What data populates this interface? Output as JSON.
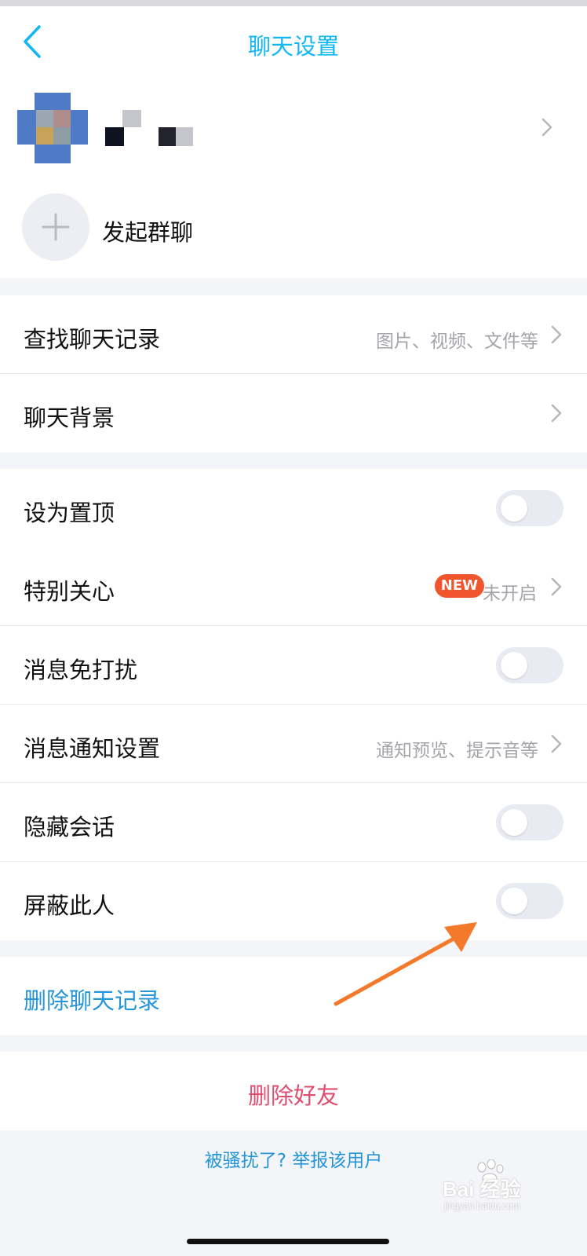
{
  "header": {
    "title": "聊天设置"
  },
  "profile": {
    "group_chat_label": "发起群聊"
  },
  "section_history": {
    "search": {
      "label": "查找聊天记录",
      "hint": "图片、视频、文件等"
    },
    "background": {
      "label": "聊天背景"
    }
  },
  "section_settings": {
    "pin": {
      "label": "设为置顶",
      "enabled": false
    },
    "special_care": {
      "label": "特别关心",
      "badge": "NEW",
      "status": "未开启"
    },
    "do_not_disturb": {
      "label": "消息免打扰",
      "enabled": false
    },
    "notification": {
      "label": "消息通知设置",
      "hint": "通知预览、提示音等"
    },
    "hide_chat": {
      "label": "隐藏会话",
      "enabled": false
    },
    "block": {
      "label": "屏蔽此人",
      "enabled": false
    }
  },
  "actions": {
    "delete_history": "删除聊天记录",
    "delete_friend": "删除好友",
    "report": "被骚扰了? 举报该用户"
  },
  "watermark": {
    "main": "Bai 经验",
    "sub": "jingyan.baidu.com"
  },
  "colors": {
    "accent": "#12b7f5",
    "link": "#2395d8",
    "danger": "#e14d6f",
    "badge": "#f0552d",
    "annotation_arrow": "#f37a2a"
  },
  "icons": {
    "back": "chevron-left-icon",
    "chevron": "chevron-right-icon",
    "plus": "plus-icon",
    "arrow": "annotation-arrow-icon"
  }
}
